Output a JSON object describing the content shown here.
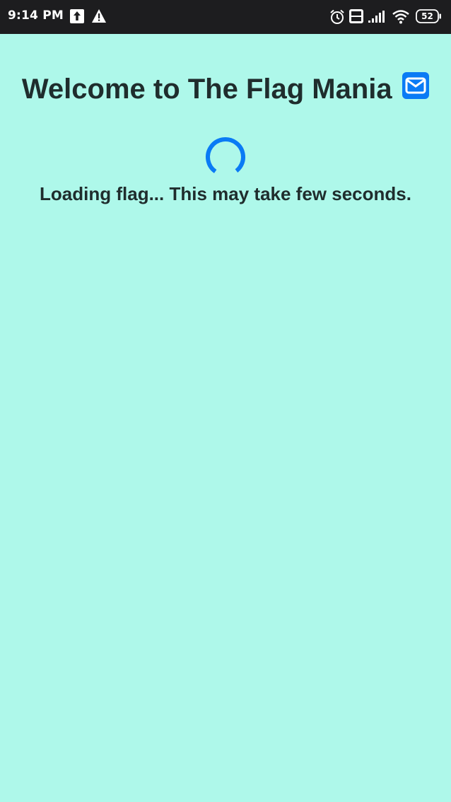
{
  "status_bar": {
    "time": "9:14 PM",
    "battery_level": "52",
    "icons": [
      "upload-icon",
      "alert-icon",
      "alarm-icon",
      "volte-icon",
      "signal-icon",
      "wifi-icon",
      "battery-icon"
    ]
  },
  "main": {
    "title": "Welcome to The Flag Mania",
    "loading_text": "Loading flag... This may take few seconds."
  },
  "colors": {
    "background": "#aef8ea",
    "accent": "#0a7bf5",
    "text": "#1f2d2d",
    "status_bar": "#1d1d1f"
  }
}
